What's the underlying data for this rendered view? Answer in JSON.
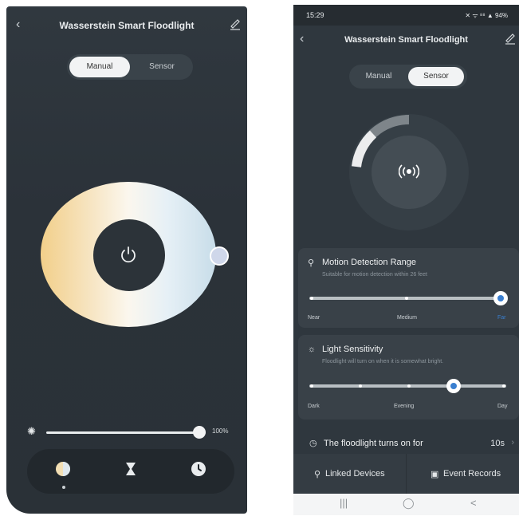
{
  "left_screen": {
    "title": "Wasserstein Smart Floodlight",
    "back_icon": "chevron-left-icon",
    "edit_icon": "edit-icon",
    "tabs": [
      {
        "label": "Manual",
        "active": true
      },
      {
        "label": "Sensor",
        "active": false
      }
    ],
    "color_wheel": {
      "center_icon": "power-icon",
      "gradient_colors": [
        "#f2cf8a",
        "#fbf7ee",
        "#c8dde9"
      ]
    },
    "brightness": {
      "icon": "sun-icon",
      "value_label": "100%",
      "level": 1.0
    },
    "modes": [
      {
        "icon": "color-mode-icon"
      },
      {
        "icon": "hourglass-icon"
      },
      {
        "icon": "clock-icon"
      }
    ]
  },
  "right_screen": {
    "status_bar": {
      "time": "15:29",
      "indicators": "✕ ᯤ ⁸⁸ ▲ 94%"
    },
    "title": "Wasserstein Smart Floodlight",
    "back_icon": "chevron-left-icon",
    "edit_icon": "edit-icon",
    "tabs": [
      {
        "label": "Manual",
        "active": false
      },
      {
        "label": "Sensor",
        "active": true
      }
    ],
    "radar": {
      "icon": "signal-broadcast-icon"
    },
    "motion_range": {
      "icon": "motion-icon",
      "title": "Motion Detection Range",
      "subtitle": "Suitable for motion detection within 26 feet",
      "labels": [
        "Near",
        "Medium",
        "Far"
      ],
      "selected": "Far",
      "selected_color": "#3a7fd0"
    },
    "light_sensitivity": {
      "icon": "brightness-icon",
      "title": "Light Sensitivity",
      "subtitle": "Floodlight will turn on when it is somewhat bright.",
      "labels": [
        "Dark",
        "Evening",
        "Day"
      ],
      "level": 0.75
    },
    "turn_on": {
      "icon": "clock-icon",
      "label": "The floodlight turns on for",
      "value": "10s"
    },
    "bottom_tabs": [
      {
        "icon": "link-icon",
        "label": "Linked Devices"
      },
      {
        "icon": "records-icon",
        "label": "Event Records"
      }
    ],
    "nav_bar": [
      "|||",
      "◯",
      "<"
    ]
  }
}
